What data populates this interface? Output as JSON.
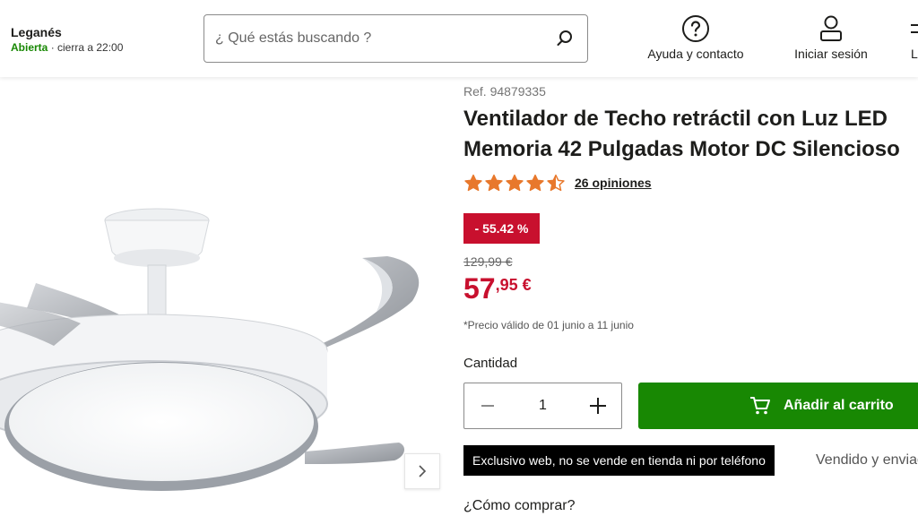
{
  "store": {
    "name": "Leganés",
    "status_open": "Abierta",
    "status_rest": "· cierra a 22:00"
  },
  "search": {
    "placeholder": "¿ Qué estás buscando ?",
    "value": ""
  },
  "nav": {
    "help": "Ayuda y contacto",
    "login": "Iniciar sesión",
    "cut": "L"
  },
  "product": {
    "ref": "Ref. 94879335",
    "title_line1": "Ventilador de Techo retráctil con Luz LED",
    "title_line2": "Memoria 42 Pulgadas Motor DC Silencioso",
    "rating": 4.5,
    "reviews": "26 opiniones",
    "discount": "- 55.42 %",
    "old_price": "129,99 €",
    "price_int": "57",
    "price_dec": ",95 €",
    "validity": "*Precio válido de 01 junio a 11 junio",
    "quantity_label": "Cantidad",
    "quantity": "1",
    "add_to_cart": "Añadir al carrito",
    "exclusive": "Exclusivo web, no se vende en tienda ni por teléfono",
    "sold_by": "Vendido y enviado",
    "how_to_buy": "¿Cómo comprar?"
  },
  "colors": {
    "brand_green": "#188803",
    "price_red": "#c8102e",
    "star_orange": "#e8782c"
  },
  "icons": {
    "search": "search-icon",
    "help": "question-circle-icon",
    "user": "user-icon",
    "next": "chevron-right-icon",
    "minus": "minus-icon",
    "plus": "plus-icon",
    "cart": "cart-icon"
  }
}
